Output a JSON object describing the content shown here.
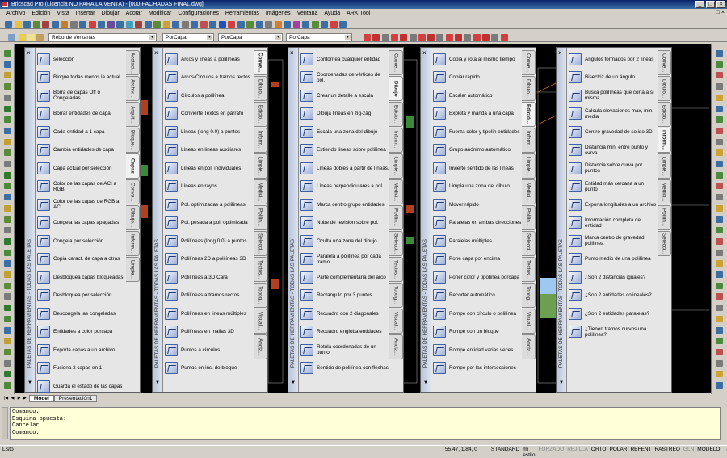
{
  "window": {
    "title": "Bricscad Pro (Licencia NO PARA LA VENTA) - [000-FACHADAS FINAL.dwg]",
    "min": "_",
    "max": "□",
    "close": "×"
  },
  "menu": [
    "Archivo",
    "Edición",
    "Vista",
    "Insertar",
    "Dibujar",
    "Acotar",
    "Modificar",
    "Configuraciones",
    "Herramientas",
    "Imágenes",
    "Ventana",
    "Ayuda",
    "ARKITool"
  ],
  "toolbar2": {
    "layer": "Reborde Ventanas",
    "color": "PorCapa",
    "linetype": "PorCapa",
    "lineweight": "PorCapa"
  },
  "palette_title": "PALETAS DE HERRAMIENTAS - TODAS LAS PALETAS",
  "palettes": [
    {
      "items": [
        "selección",
        "Bloque todas menos la actual",
        "Borra de capas Off o Congeladas",
        "Borrar entidades de capa",
        "Cada entidad a 1 capa",
        "Cambia entidades de capa",
        "Capa actual por selección",
        "Color de las capas de ACI a RGB",
        "Color de las capas de RGB a ACI",
        "Congela las capas apagadas",
        "Congela por selección",
        "Copia caract. de capa a otras",
        "Desbloquea capas bloqueadas",
        "Desbloquea por selección",
        "Descongela las congeladas",
        "Entidades a color porcapa",
        "Exporta capas a un archivo",
        "Fusiona 2 capas en 1",
        "Guarda el estado de las capas"
      ],
      "tabs": [
        "Acotaci...",
        "Archiv...",
        "Arquit...",
        "Bloque...",
        "Capas",
        "Conve...",
        "Dibujo...",
        "Inform...",
        "Limpie..."
      ],
      "active": 4
    },
    {
      "items": [
        "Arcos y lineas a polilíneas",
        "Arcos/Circulos a tramos rectos",
        "Círculos a polilínea",
        "Convierte Textos en párrafo",
        "Líneas (long 0.0) a puntos",
        "Líneas en lineas auxiliares",
        "Líneas en pol. individuales",
        "Líneas en rayos",
        "Pol. optimizadas a polilíneas",
        "Pol. pesada a pol. optimizada",
        "Polilíneas (long 0.0) a puntos",
        "Polilíneas 2D a polilíneas 3D",
        "Polilíneas a 3D Cara",
        "Polilíneas a tramos rectos",
        "Polilíneas en lineas múltiples",
        "Polilíneas en mallas 3D",
        "Puntos a círculos",
        "Puntos en ins. de bloque"
      ],
      "tabs": [
        "Conve...",
        "Dibujo...",
        "Edicio...",
        "Inform...",
        "Limpie...",
        "Medici...",
        "Polilin...",
        "Selecci...",
        "Textos...",
        "Topog...",
        "Visual...",
        "Anota..."
      ],
      "active": 0
    },
    {
      "items": [
        "Contornea cualquier entidad",
        "Coordenadas de vértices de pol.",
        "Crear un detalle a escala",
        "Dibuja líneas en zig-zag",
        "Escala una zona del dibujo",
        "Extiendo líneas sobre polilínea",
        "Líneas dobles a partir de líneas.",
        "Líneas perpendiculares a pol.",
        "Marca centro grupo entidades",
        "Nube de revisión sobre pol.",
        "Oculta una zona del dibujo",
        "Paralela a polilínea por cada tramo.",
        "Parte complementaria del arco",
        "Rectangulo por 3 puntos",
        "Recuadro con 2 diagonales",
        "Recuadro engloba entidades",
        "Rotula coordenadas de un punto",
        "Sentido de polilínea con flechas"
      ],
      "tabs": [
        "Conve...",
        "Dibujo",
        "Edicio...",
        "Inform...",
        "Limpie...",
        "Medici...",
        "Polilin...",
        "Selecci...",
        "Textos...",
        "Topog...",
        "Visual...",
        "Anota..."
      ],
      "active": 1
    },
    {
      "items": [
        "Copia y rota al mismo tiempo",
        "Copiar rápido",
        "Escalar automático",
        "Explota y manda a una capa",
        "Fuerza color y tipolín entidades",
        "Grupo anónimo automático",
        "Invierte sentido de las líneas",
        "Limpia una zona del dibujo",
        "Mover rápido",
        "Paralelas en ambas direcciones",
        "Paralelas múltiples",
        "Pone capa por encima",
        "Poner color y tipolínea porcapa",
        "Recortar automático",
        "Rompe con círculo o polilínea",
        "Rompe con un bloque",
        "Rompe entidad varias veces",
        "Rompe por las intersecciones"
      ],
      "tabs": [
        "Conve...",
        "Dibujo...",
        "Edició...",
        "Inform...",
        "Limpie...",
        "Medici...",
        "Polilin...",
        "Selecci...",
        "Textos...",
        "Topog...",
        "Visual...",
        "Anota..."
      ],
      "active": 2
    },
    {
      "items": [
        "Angulos formados por 2 líneas",
        "Bisectriz de un ángulo",
        "Busca polilíneas que corta a sí misma",
        "Calcula elevaciones max, min, media",
        "Centro gravedad de solido 3D",
        "Distancia min. entre punto y curva",
        "Distancia sobre curva por puntos",
        "Entidad más cercana a un punto",
        "Exporta longitudes a un archivo",
        "Información completa de entidad",
        "Marca centro de gravedad polilínea",
        "Punto medio de una polilínea",
        "¿Son 2 distancias iguales?",
        "¿Son 2 entidades colineales?",
        "¿Son 2 entidades paralelas?",
        "¿Tienen tramos curvos una polilínea?"
      ],
      "tabs": [
        "Conve...",
        "Dibujo...",
        "Edicio...",
        "Inform...",
        "Limpie...",
        "Medici...",
        "Polilin...",
        "Selecci..."
      ],
      "active": 3
    }
  ],
  "model_tabs": [
    "Model",
    "Presentación1"
  ],
  "command_lines": [
    "Comando:",
    "Esquina opuesta:",
    "Cancelar",
    "Comando:"
  ],
  "status": {
    "text": "Listo",
    "coords": "55.47, 1.84, 0",
    "modes": [
      {
        "label": "STANDARD",
        "on": true
      },
      {
        "label": "mi estilo",
        "on": true
      },
      {
        "label": "FORZADO",
        "on": false
      },
      {
        "label": "REJILLA",
        "on": false
      },
      {
        "label": "ORTO",
        "on": true
      },
      {
        "label": "POLAR",
        "on": true
      },
      {
        "label": "REFENT",
        "on": true
      },
      {
        "label": "RASTREO",
        "on": true
      },
      {
        "label": "GLN",
        "on": false
      },
      {
        "label": "MODELO",
        "on": true
      },
      {
        "label": "TABLERO",
        "on": false
      }
    ]
  },
  "colors": {
    "palette_bg": "#e6e6e6",
    "title_grad": "#0a246a",
    "drawing_bg": "#000000",
    "command_bg": "#ffffd8"
  }
}
